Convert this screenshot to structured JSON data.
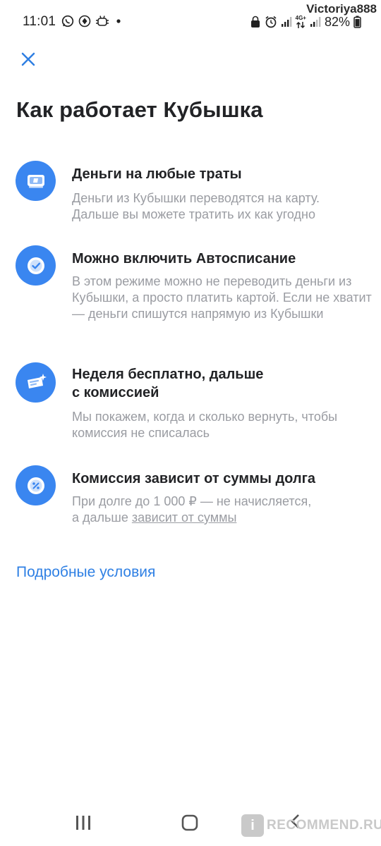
{
  "status_bar": {
    "time": "11:01",
    "battery": "82%",
    "network": "4G+",
    "left_icons": [
      "whatsapp-icon",
      "navigation-icon",
      "android-debug-icon",
      "notification-dot-icon"
    ],
    "right_icons": [
      "lock-icon",
      "alarm-icon",
      "signal-icon",
      "data-arrows-icon",
      "signal-icon",
      "battery-icon"
    ]
  },
  "watermark": {
    "username": "Victoriya888",
    "site": "RECOMMEND.RU",
    "badge": "i"
  },
  "header": {
    "close_icon": "close-icon",
    "title": "Как работает Кубышка"
  },
  "features": [
    {
      "icon": "money-icon",
      "title": "Деньги на любые траты",
      "description": "Деньги из Кубышки переводятся на карту. Дальше вы можете тратить их как угодно"
    },
    {
      "icon": "checkmark-icon",
      "title": "Можно включить Автосписание",
      "description": "В этом режиме можно не переводить деньги из Кубышки, а просто платить картой. Если не хватит — деньги спишутся напрямую из Кубышки"
    },
    {
      "icon": "ticket-sparkle-icon",
      "title_line1": "Неделя бесплатно, дальше",
      "title_line2": "с комиссией",
      "description": "Мы покажем, когда и сколько вернуть, чтобы комиссия не списалась"
    },
    {
      "icon": "percent-icon",
      "title": "Комиссия зависит от суммы долга",
      "description_line1": "При долге до 1 000 ₽ — не начисляется,",
      "description_prefix": "а дальше ",
      "description_link": "зависит от суммы"
    }
  ],
  "details_link": "Подробные условия",
  "colors": {
    "accent": "#3a86f0",
    "link": "#2f80e4",
    "title": "#222326",
    "secondary_text": "#9a9ca2"
  },
  "nav_bar": {
    "icons": [
      "recents-icon",
      "home-icon",
      "back-icon"
    ]
  }
}
